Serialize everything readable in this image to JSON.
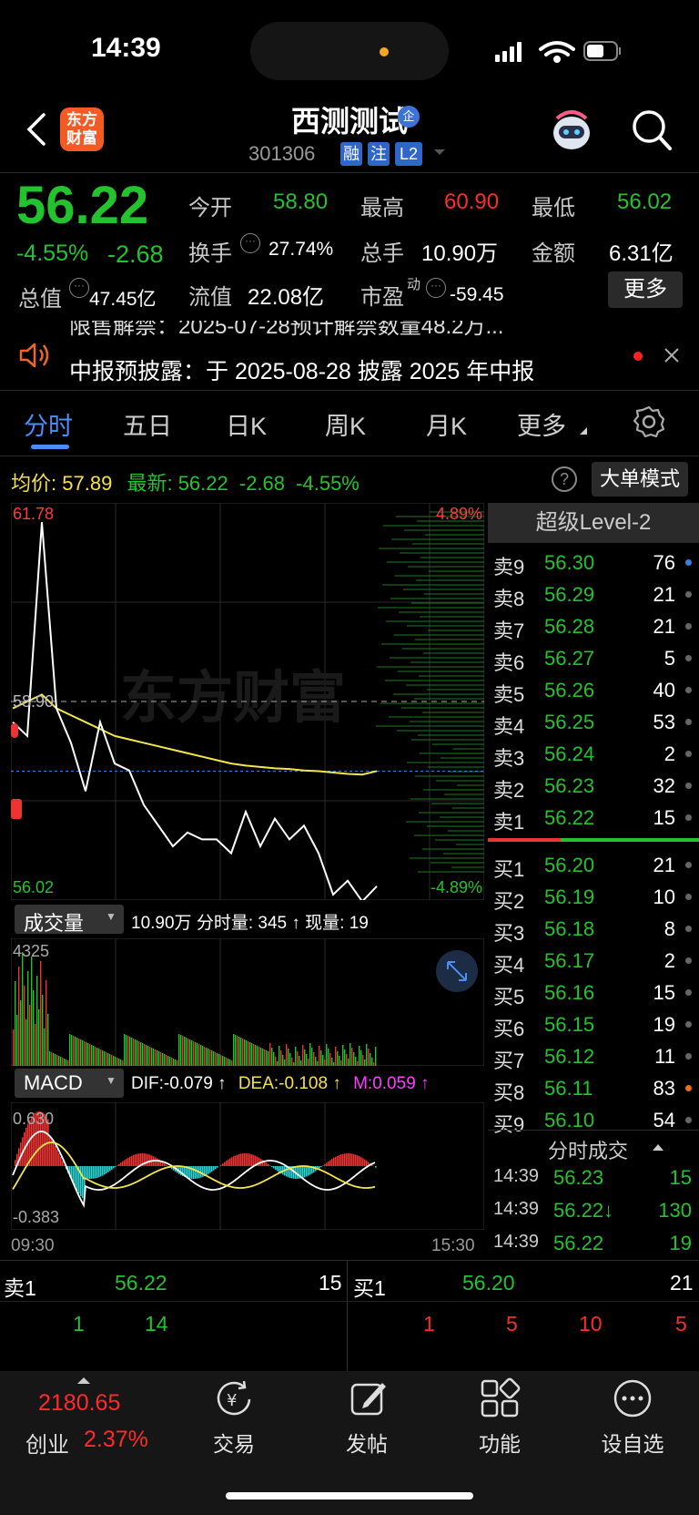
{
  "status": {
    "time": "14:39"
  },
  "header": {
    "logo_text": "东方\n财富",
    "name": "西测测试",
    "badge": "企",
    "code": "301306",
    "tags": [
      "融",
      "注",
      "L2"
    ]
  },
  "quote": {
    "price": "56.22",
    "change_pct": "-4.55%",
    "change": "-2.68",
    "open_label": "今开",
    "open": "58.80",
    "high_label": "最高",
    "high": "60.90",
    "low_label": "最低",
    "low": "56.02",
    "turnover_label": "换手",
    "turnover": "27.74%",
    "vol_label": "总手",
    "vol": "10.90万",
    "amount_label": "金额",
    "amount": "6.31亿",
    "mcap_label": "总值",
    "mcap": "47.45亿",
    "float_label": "流值",
    "float": "22.08亿",
    "pe_label": "市盈",
    "pe_sup": "动",
    "pe": "-59.45",
    "more": "更多"
  },
  "notice": {
    "prev_partial": "限售解禁：2025-07-28预计解禁数量48.2万...",
    "text": "中报预披露：于 2025-08-28 披露 2025 年中报"
  },
  "tabs": [
    "分时",
    "五日",
    "日K",
    "周K",
    "月K",
    "更多"
  ],
  "chart_header": {
    "avg_label": "均价:",
    "avg": "57.89",
    "last_label": "最新:",
    "last": "56.22",
    "chg": "-2.68",
    "chg_pct": "-4.55%",
    "big_order": "大单模式"
  },
  "chart_labels": {
    "y_max": "61.78",
    "y_min": "56.02",
    "y_mid": "58.90",
    "pct_max": "4.89%",
    "pct_min": "-4.89%",
    "watermark": "东方财富",
    "vol_selector": "成交量",
    "vol_info": "10.90万 分时量: 345 ↑ 现量: 19",
    "vol_max": "4325",
    "macd_selector": "MACD",
    "dif": "DIF:-0.079 ↑",
    "dea": "DEA:-0.108 ↑",
    "m": "M:0.059 ↑",
    "macd_max": "0.630",
    "macd_min": "-0.383",
    "t_start": "09:30",
    "t_end": "15:30"
  },
  "chart_data": {
    "type": "line",
    "title": "",
    "x": [
      "09:30",
      "09:35",
      "09:40",
      "09:45",
      "09:50",
      "09:55",
      "10:00",
      "10:10",
      "10:20",
      "10:30",
      "10:40",
      "10:50",
      "11:00",
      "11:10",
      "11:20",
      "11:30",
      "13:10",
      "13:20",
      "13:30",
      "13:40",
      "13:50",
      "14:00",
      "14:10",
      "14:20",
      "14:30",
      "14:39"
    ],
    "series": [
      {
        "name": "最新",
        "values": [
          58.6,
          58.4,
          61.5,
          58.8,
          58.3,
          57.6,
          58.6,
          58.0,
          57.9,
          57.4,
          57.1,
          56.8,
          57.0,
          56.9,
          56.9,
          56.7,
          57.3,
          56.8,
          57.2,
          56.9,
          57.1,
          56.7,
          56.1,
          56.3,
          56.0,
          56.22
        ]
      },
      {
        "name": "均价",
        "values": [
          58.8,
          58.9,
          59.0,
          58.8,
          58.7,
          58.6,
          58.5,
          58.4,
          58.35,
          58.3,
          58.25,
          58.2,
          58.15,
          58.1,
          58.05,
          58.0,
          57.97,
          57.95,
          57.93,
          57.92,
          57.9,
          57.89,
          57.87,
          57.85,
          57.84,
          57.89
        ]
      }
    ],
    "ylim": [
      56.02,
      61.78
    ],
    "pre_close": 58.9
  },
  "level2": {
    "title": "超级Level-2",
    "asks": [
      {
        "label": "卖9",
        "price": "56.30",
        "vol": "76"
      },
      {
        "label": "卖8",
        "price": "56.29",
        "vol": "21"
      },
      {
        "label": "卖7",
        "price": "56.28",
        "vol": "21"
      },
      {
        "label": "卖6",
        "price": "56.27",
        "vol": "5"
      },
      {
        "label": "卖5",
        "price": "56.26",
        "vol": "40"
      },
      {
        "label": "卖4",
        "price": "56.25",
        "vol": "53"
      },
      {
        "label": "卖3",
        "price": "56.24",
        "vol": "2"
      },
      {
        "label": "卖2",
        "price": "56.23",
        "vol": "32"
      },
      {
        "label": "卖1",
        "price": "56.22",
        "vol": "15"
      }
    ],
    "bids": [
      {
        "label": "买1",
        "price": "56.20",
        "vol": "21"
      },
      {
        "label": "买2",
        "price": "56.19",
        "vol": "10"
      },
      {
        "label": "买3",
        "price": "56.18",
        "vol": "8"
      },
      {
        "label": "买4",
        "price": "56.17",
        "vol": "2"
      },
      {
        "label": "买5",
        "price": "56.16",
        "vol": "15"
      },
      {
        "label": "买6",
        "price": "56.15",
        "vol": "19"
      },
      {
        "label": "买7",
        "price": "56.12",
        "vol": "11"
      },
      {
        "label": "买8",
        "price": "56.11",
        "vol": "83"
      },
      {
        "label": "买9",
        "price": "56.10",
        "vol": "54"
      }
    ],
    "ticks_title": "分时成交",
    "ticks": [
      {
        "time": "14:39",
        "price": "56.23",
        "vol": "15"
      },
      {
        "time": "14:39",
        "price": "56.22↓",
        "vol": "130"
      },
      {
        "time": "14:39",
        "price": "56.22",
        "vol": "19"
      }
    ]
  },
  "queue": {
    "ask_label": "卖1",
    "ask_price": "56.22",
    "ask_vol": "15",
    "bid_label": "买1",
    "bid_price": "56.20",
    "bid_vol": "21",
    "ask_orders": [
      "1",
      "14"
    ],
    "bid_orders": [
      "1",
      "5",
      "10",
      "5"
    ]
  },
  "bottom": {
    "index_value": "2180.65",
    "index_name": "创业",
    "index_pct": "2.37%",
    "nav": [
      "交易",
      "发帖",
      "功能",
      "设自选"
    ]
  }
}
